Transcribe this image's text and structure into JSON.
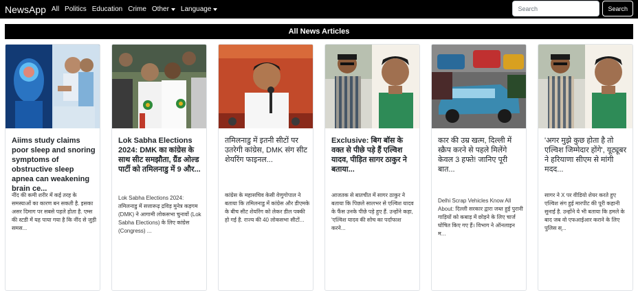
{
  "nav": {
    "brand": "NewsApp",
    "items": [
      {
        "label": "All"
      },
      {
        "label": "Politics"
      },
      {
        "label": "Education"
      },
      {
        "label": "Crime"
      },
      {
        "label": "Other"
      },
      {
        "label": "Language"
      }
    ],
    "search_placeholder": "Search",
    "search_button": "Search"
  },
  "heading": "All News Articles",
  "articles": [
    {
      "title": "Aiims study claims poor sleep and snoring symptoms of obstructive sleep apnea can weakening brain ce...",
      "description": "नींद की कमी शरीर में कई तरह के समस्याओं का कारण बन सकती है. इसका असर दिमाग पर सबसे पहले होता है. एम्स की स्टडी में यह पाया गया है कि नींद से जुड़ी समस..."
    },
    {
      "title": "Lok Sabha Elections 2024: DMK का कांग्रेस के साथ सीट समझौता, ग्रैंड ओल्ड पार्टी को तमिलनाडु में 9 और...",
      "description": "Lok Sabha Elections 2024: तमिलनाडु में सत्तारूढ़ द्रविड़ मुनेत्र कड़गम (DMK) ने आगामी लोकसभा चुनावों (Lok Sabha Elections) के लिए कांग्रेस (Congress) ..."
    },
    {
      "title": "तमिलनाडु में इतनी सीटों पर उतरेगी कांग्रेस, DMK संग सीट शेयरिंग फाइनल...",
      "description": "कांग्रेस के महासचिव केसी वेणुगोपाल ने बताया कि तमिलनाडु में कांग्रेस और डीएमके के बीच सीट शेयरिंग को लेकर डील पक्की हो गई है. राज्य की 40 लोकसभा सीटों..."
    },
    {
      "title": "Exclusive: बिग बॉस के वक्त से पीछे पड़े हैं एल्विश यादव, पीड़ित सागर ठाकुर ने बताया...",
      "description": "आजतक से बातचीत में सागर ठाकुर ने बताया कि पिछले सालभर से एल्विश यादव के फैंस उनके पीछे पड़े हुए हैं. उन्होंने कहा, 'एल्विश यादव की सोच का पर्दाफाश करने..."
    },
    {
      "title": "कार की उम्र खत्म, दिल्ली में स्क्रैप करने से पहले मिलेंगे केवल 3 हफ्ते! जानिए पूरी बात...",
      "description": "Delhi Scrap Vehicles Know All About: दिल्ली सरकार द्वारा जब्त हुई पुरानी गाड़ियों को कबाड़ में छोड़ने के लिए चार्ज घोषित किए गए हैं। विभाग ने ऑनलाइन म..."
    },
    {
      "title": "'अगर मुझे कुछ होता है तो एल्विश जिम्मेदार होंगे', यूट्यूबर ने हरियाणा सीएम से मांगी मदद...",
      "description": "सागर ने X पर वीडियो शेयर करते हुए एल्विश संग हुई मारपीट की पूरी कहानी सुनाई है. उन्होंने ये भी बताया कि हमले के बाद जब वो एफआईआर कराने के लिए पुलिस स्..."
    }
  ]
}
